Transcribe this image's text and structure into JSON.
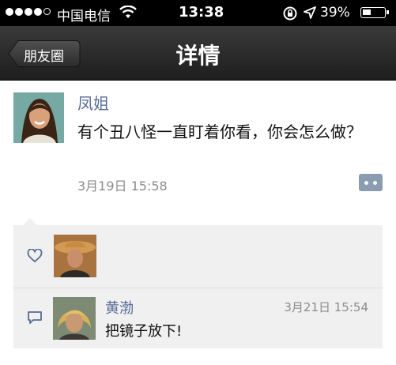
{
  "status_bar": {
    "carrier": "中国电信",
    "time": "13:38",
    "battery_percent": "39%",
    "battery_level": 0.39,
    "signal_bars": 4,
    "icons": [
      "signal-dots-icon",
      "wifi-icon",
      "rotation-lock-icon",
      "location-arrow-icon",
      "battery-icon"
    ]
  },
  "nav": {
    "back_label": "朋友圈",
    "title": "详情"
  },
  "post": {
    "author": "凤姐",
    "text": "有个丑八怪一直盯着你看，你会怎么做？",
    "time": "3月19日 15:58",
    "more_icon": "more-dots-icon"
  },
  "likes": {
    "icon": "heart-icon",
    "count_shown": 1
  },
  "comments": [
    {
      "author": "黄渤",
      "time": "3月21日 15:54",
      "text": "把镜子放下!",
      "icon": "comment-bubble-icon"
    }
  ],
  "colors": {
    "name_blue": "#576b95",
    "timestamp_gray": "#8b8b8b",
    "comment_bg": "#f0f0f0",
    "navbar_dark": "#2a2a2a"
  }
}
